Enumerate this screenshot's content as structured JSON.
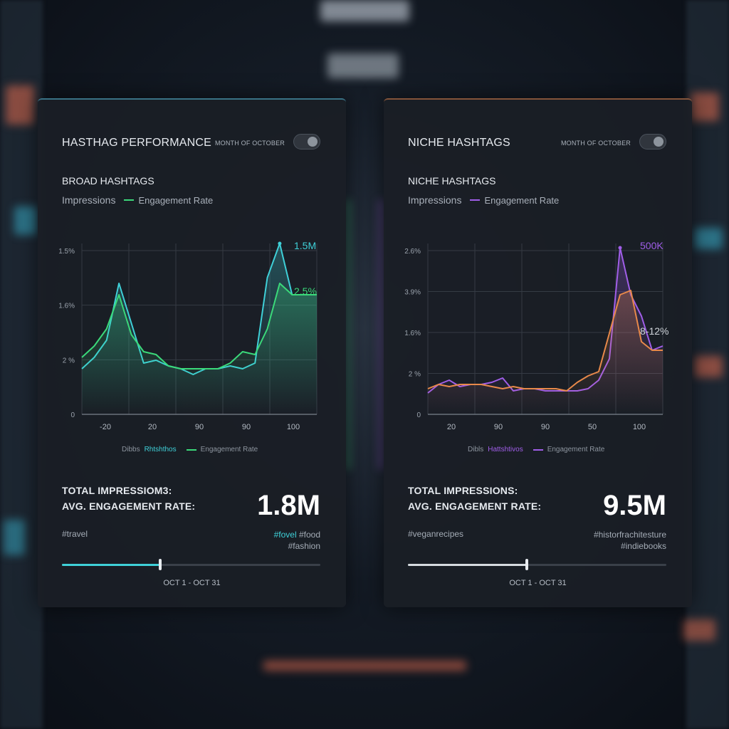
{
  "colors": {
    "left_accent": "#3fd0d8",
    "left_secondary": "#3bd97a",
    "right_accent": "#a05ee8",
    "right_secondary": "#e8894a"
  },
  "left": {
    "title": "HASTHAG PERFORMANCE",
    "month_label": "MONTH OF OCTOBER",
    "subtitle": "BROAD HASHTAGS",
    "legend_impressions": "Impressions",
    "legend_engagement": "Engagement Rate",
    "legend_bottom_a": "Dibbs",
    "legend_bottom_b": "Rhtshthos",
    "legend_bottom_c": "Engagement Rate",
    "total_label": "TOTAL IMPRESSIOM3:",
    "avg_label": "AVG. ENGAGEMENT RATE:",
    "big_value": "1.8M",
    "tag_left": "#travel",
    "tag_right_1": "#fovel",
    "tag_right_2": "#food",
    "tag_right_3": "#fashion",
    "date_range": "OCT 1 - OCT 31",
    "slider_progress": 0.38
  },
  "right": {
    "title": "NICHE HASHTAGS",
    "month_label": "MONTH OF OCTOBER",
    "subtitle": "NICHE HASHTAGS",
    "legend_impressions": "Impressions",
    "legend_engagement": "Engagement Rate",
    "legend_bottom_a": "Dibls",
    "legend_bottom_b": "Hattshtivos",
    "legend_bottom_c": "Engagement Rate",
    "total_label": "TOTAL IMPRESSIONS:",
    "avg_label": "AVG. ENGAGEMENT RATE:",
    "big_value": "9.5M",
    "tag_left": "#veganrecipes",
    "tag_right_1": "#historfrachitesture",
    "tag_right_2": "#indiebooks",
    "date_range": "OCT 1 - OCT 31",
    "slider_progress": 0.46
  },
  "chart_data": [
    {
      "type": "line",
      "title": "BROAD HASHTAGS",
      "x_ticks": [
        "-20",
        "20",
        "90",
        "90",
        "100"
      ],
      "y_ticks": [
        "0",
        "2 %",
        "1.6%",
        "1.5%"
      ],
      "ylim": [
        0,
        3
      ],
      "grid": true,
      "annotations": [
        "1.5M",
        "2.5%"
      ],
      "series": [
        {
          "name": "Impressions",
          "values": [
            0.8,
            1.0,
            1.3,
            2.3,
            1.6,
            0.9,
            0.95,
            0.85,
            0.8,
            0.7,
            0.8,
            0.8,
            0.85,
            0.8,
            0.9,
            2.4,
            3.0,
            2.1,
            2.1,
            2.1
          ]
        },
        {
          "name": "Engagement Rate",
          "values": [
            1.0,
            1.2,
            1.5,
            2.1,
            1.4,
            1.1,
            1.05,
            0.85,
            0.8,
            0.8,
            0.8,
            0.8,
            0.9,
            1.1,
            1.05,
            1.5,
            2.3,
            2.1,
            2.1,
            2.1
          ]
        }
      ]
    },
    {
      "type": "line",
      "title": "NICHE HASHTAGS",
      "x_ticks": [
        "20",
        "90",
        "90",
        "50",
        "100"
      ],
      "y_ticks": [
        "0",
        "2 %",
        "1.6%",
        "3.9%",
        "2.6%"
      ],
      "ylim": [
        0,
        4
      ],
      "grid": true,
      "annotations": [
        "500K",
        "8-12%"
      ],
      "series": [
        {
          "name": "Impressions",
          "values": [
            0.5,
            0.7,
            0.8,
            0.65,
            0.7,
            0.7,
            0.75,
            0.85,
            0.55,
            0.6,
            0.6,
            0.55,
            0.55,
            0.55,
            0.55,
            0.6,
            0.8,
            1.3,
            3.9,
            2.8,
            2.3,
            1.5,
            1.6
          ]
        },
        {
          "name": "Engagement Rate",
          "values": [
            0.6,
            0.7,
            0.65,
            0.7,
            0.7,
            0.7,
            0.65,
            0.6,
            0.65,
            0.6,
            0.6,
            0.6,
            0.6,
            0.55,
            0.75,
            0.9,
            1.0,
            1.9,
            2.8,
            2.9,
            1.7,
            1.5,
            1.5
          ]
        }
      ]
    }
  ]
}
